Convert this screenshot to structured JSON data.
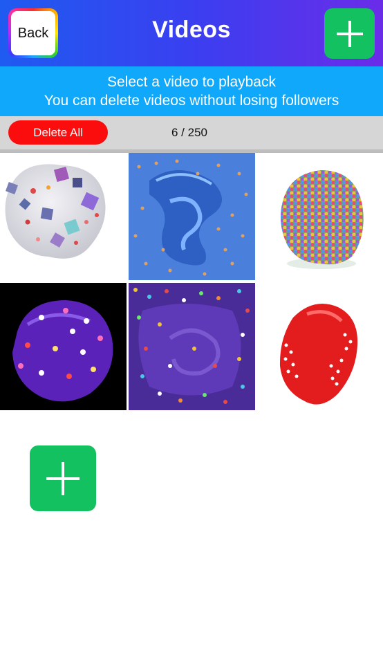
{
  "header": {
    "back_label": "Back",
    "title": "Videos"
  },
  "banner": {
    "line1": "Select a video to playback",
    "line2": "You can delete videos without losing followers"
  },
  "toolbar": {
    "delete_all_label": "Delete All",
    "count_text": "6 / 250"
  },
  "videos": [
    {
      "name": "clear slime with cubes"
    },
    {
      "name": "blue slime with beads"
    },
    {
      "name": "rainbow bead ball slime"
    },
    {
      "name": "purple slime with candies"
    },
    {
      "name": "purple slime with sprinkles"
    },
    {
      "name": "red slime with white dots"
    }
  ],
  "colors": {
    "header_gradient": [
      "#1f5bf0",
      "#6b2ce8"
    ],
    "banner": "#10a8fb",
    "add_button": "#14c160",
    "delete_button": "#fb0d0d",
    "toolbar": "#d6d6d6"
  },
  "icons": {
    "add": "plus-icon"
  }
}
